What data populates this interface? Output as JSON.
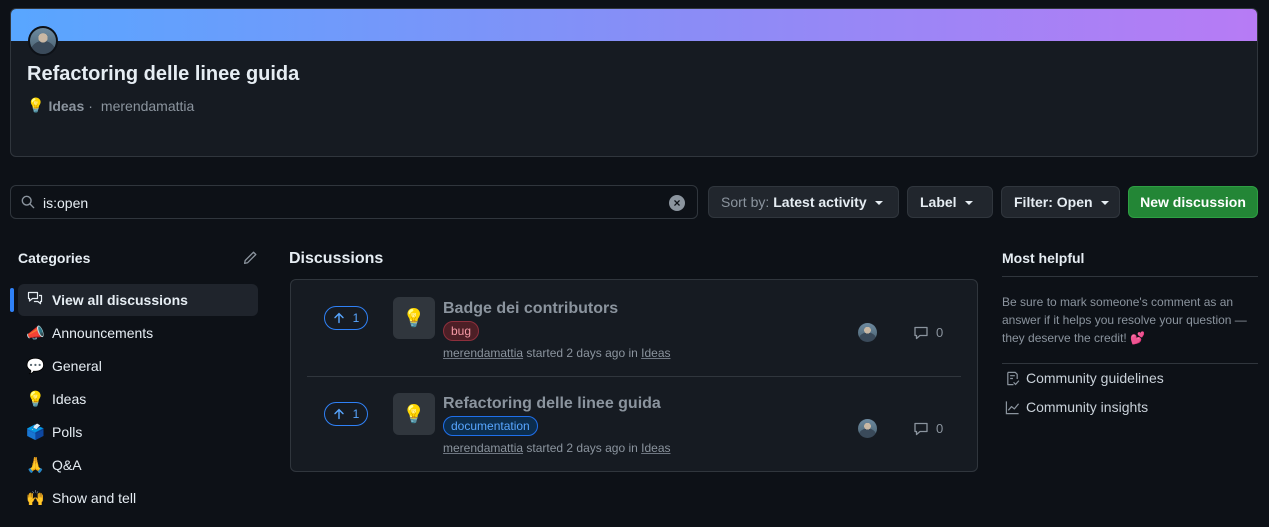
{
  "header": {
    "title": "Refactoring delle linee guida",
    "category_emoji": "💡",
    "category": "Ideas",
    "separator": "·",
    "author": "merendamattia"
  },
  "toolbar": {
    "search_value": "is:open",
    "clear_icon": "×",
    "sort_prefix": "Sort by:",
    "sort_value": "Latest activity",
    "label_button": "Label",
    "filter_button": "Filter: Open",
    "new_discussion": "New discussion"
  },
  "categories": {
    "heading": "Categories",
    "items": [
      {
        "emoji": "",
        "label": "View all discussions",
        "active": true
      },
      {
        "emoji": "📣",
        "label": "Announcements"
      },
      {
        "emoji": "💬",
        "label": "General"
      },
      {
        "emoji": "💡",
        "label": "Ideas"
      },
      {
        "emoji": "🗳️",
        "label": "Polls"
      },
      {
        "emoji": "🙏",
        "label": "Q&A"
      },
      {
        "emoji": "🙌",
        "label": "Show and tell"
      }
    ]
  },
  "discussions": {
    "heading": "Discussions",
    "rows": [
      {
        "votes": "1",
        "icon": "💡",
        "title": "Badge dei contributors",
        "label": "bug",
        "author": "merendamattia",
        "started": "started 2 days ago in",
        "category": "Ideas",
        "comments": "0"
      },
      {
        "votes": "1",
        "icon": "💡",
        "title": "Refactoring delle linee guida",
        "label": "documentation",
        "author": "merendamattia",
        "started": "started 2 days ago in",
        "category": "Ideas",
        "comments": "0"
      }
    ]
  },
  "most_helpful": {
    "heading": "Most helpful",
    "text": "Be sure to mark someone's comment as an answer if it helps you resolve your question — they deserve the credit!",
    "emoji": "💕",
    "links": [
      {
        "label": "Community guidelines",
        "icon": "guidelines-icon"
      },
      {
        "label": "Community insights",
        "icon": "insights-icon"
      }
    ]
  },
  "colors": {
    "accent": "#2f81f7",
    "primary_button": "#238636",
    "bug_label": "#f59aa6",
    "documentation_label": "#58a6ff"
  }
}
